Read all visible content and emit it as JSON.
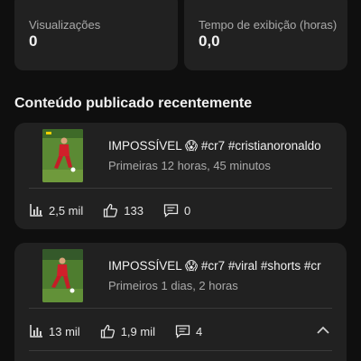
{
  "stats": {
    "views": {
      "label": "Visualizações",
      "value": "0"
    },
    "watch_time": {
      "label": "Tempo de exibição (horas)",
      "value": "0,0"
    }
  },
  "section_title": "Conteúdo publicado recentemente",
  "items": [
    {
      "title": "IMPOSSÍVEL 😱 #cr7 #cristianoronaldo",
      "subtitle": "Primeiras 12 horas, 45 minutos",
      "views": "2,5 mil",
      "likes": "133",
      "comments": "0"
    },
    {
      "title": "IMPOSSÍVEL 😱 #cr7 #viral #shorts #cr",
      "subtitle": "Primeiros 1 dias, 2 horas",
      "views": "13 mil",
      "likes": "1,9 mil",
      "comments": "4"
    }
  ],
  "colors": {
    "background": "#0f0f0f",
    "card": "#212121",
    "text_primary": "#f1f1f1",
    "text_secondary": "#aaaaaa"
  },
  "icons": {
    "views": "bar-chart-icon",
    "likes": "thumbs-up-icon",
    "comments": "comment-icon",
    "expand": "chevron-up-icon"
  }
}
